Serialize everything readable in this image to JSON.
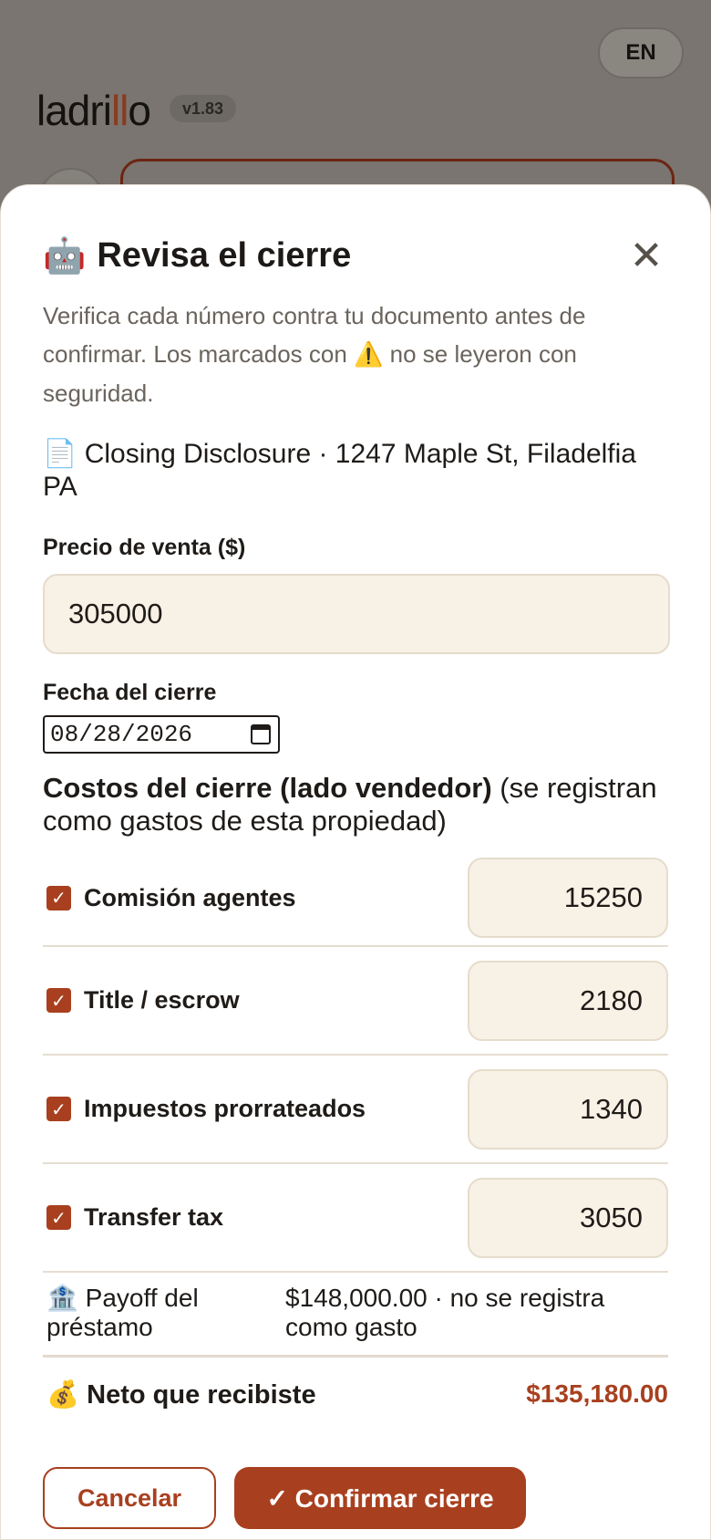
{
  "background": {
    "lang_button": "EN",
    "logo_pre": "ladri",
    "logo_accent": "ll",
    "logo_post": "o",
    "version": "v1.83"
  },
  "modal": {
    "title_icon": "🤖",
    "title": "Revisa el cierre",
    "close_icon": "✕",
    "subtitle_part1": "Verifica cada número contra tu documento antes de confirmar. Los marcados con ",
    "warning_icon": "⚠️",
    "subtitle_part2": " no se leyeron con seguridad.",
    "doc_icon": "📄",
    "doc_ref": "Closing Disclosure · 1247 Maple St, Filadelfia PA",
    "price_label": "Precio de venta ($)",
    "price_value": "305000",
    "date_label": "Fecha del cierre",
    "date_value": "08/28/2026",
    "costs_title_bold": "Costos del cierre (lado vendedor)",
    "costs_title_rest": " (se registran como gastos de esta propiedad)",
    "costs": [
      {
        "label": "Comisión agentes",
        "value": "15250",
        "checked": true
      },
      {
        "label": "Title / escrow",
        "value": "2180",
        "checked": true
      },
      {
        "label": "Impuestos prorrateados",
        "value": "1340",
        "checked": true
      },
      {
        "label": "Transfer tax",
        "value": "3050",
        "checked": true
      }
    ],
    "payoff_icon": "🏦",
    "payoff_label": "Payoff del préstamo",
    "payoff_value": "$148,000.00 · no se registra como gasto",
    "net_icon": "💰",
    "net_label": "Neto que recibiste",
    "net_value": "$135,180.00",
    "cancel_label": "Cancelar",
    "confirm_label": "✓ Confirmar cierre"
  },
  "colors": {
    "accent": "#a8401f",
    "input_bg": "#f8f1e6",
    "overlay": "#7a7570"
  }
}
